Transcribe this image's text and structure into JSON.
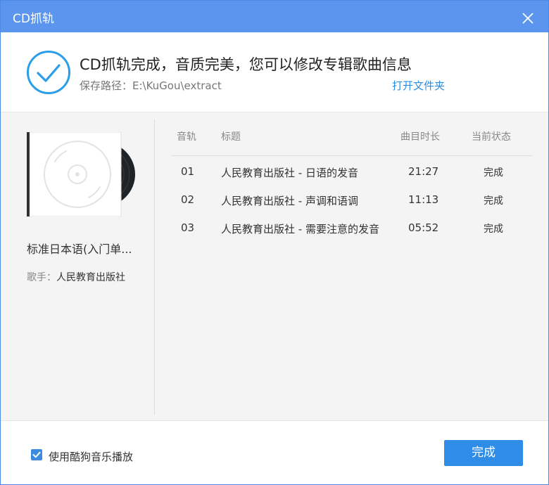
{
  "window": {
    "title": "CD抓轨"
  },
  "header": {
    "headline": "CD抓轨完成，音质完美，您可以修改专辑歌曲信息",
    "path": "保存路径：E:\\KuGou\\extract",
    "open_folder": "打开文件夹"
  },
  "album": {
    "name": "标准日本语(入门单...",
    "artist_label": "歌手：",
    "artist": "人民教育出版社"
  },
  "table": {
    "columns": [
      "音轨",
      "标题",
      "曲目时长",
      "当前状态"
    ],
    "rows": [
      {
        "track": "01",
        "title": "人民教育出版社 - 日语的发音",
        "duration": "21:27",
        "status": "完成"
      },
      {
        "track": "02",
        "title": "人民教育出版社 - 声调和语调",
        "duration": "11:13",
        "status": "完成"
      },
      {
        "track": "03",
        "title": "人民教育出版社 - 需要注意的发音",
        "duration": "05:52",
        "status": "完成"
      }
    ]
  },
  "footer": {
    "use_player_label": "使用酷狗音乐播放",
    "use_player_checked": true,
    "done_label": "完成"
  },
  "colors": {
    "titlebar": "#5b95ee",
    "accent": "#2f8de8",
    "check": "#2a9ee8"
  },
  "icons": {
    "close": "close-icon",
    "success": "check-circle-icon",
    "cover": "cd-disc-icon",
    "checkbox": "checkmark-icon"
  }
}
